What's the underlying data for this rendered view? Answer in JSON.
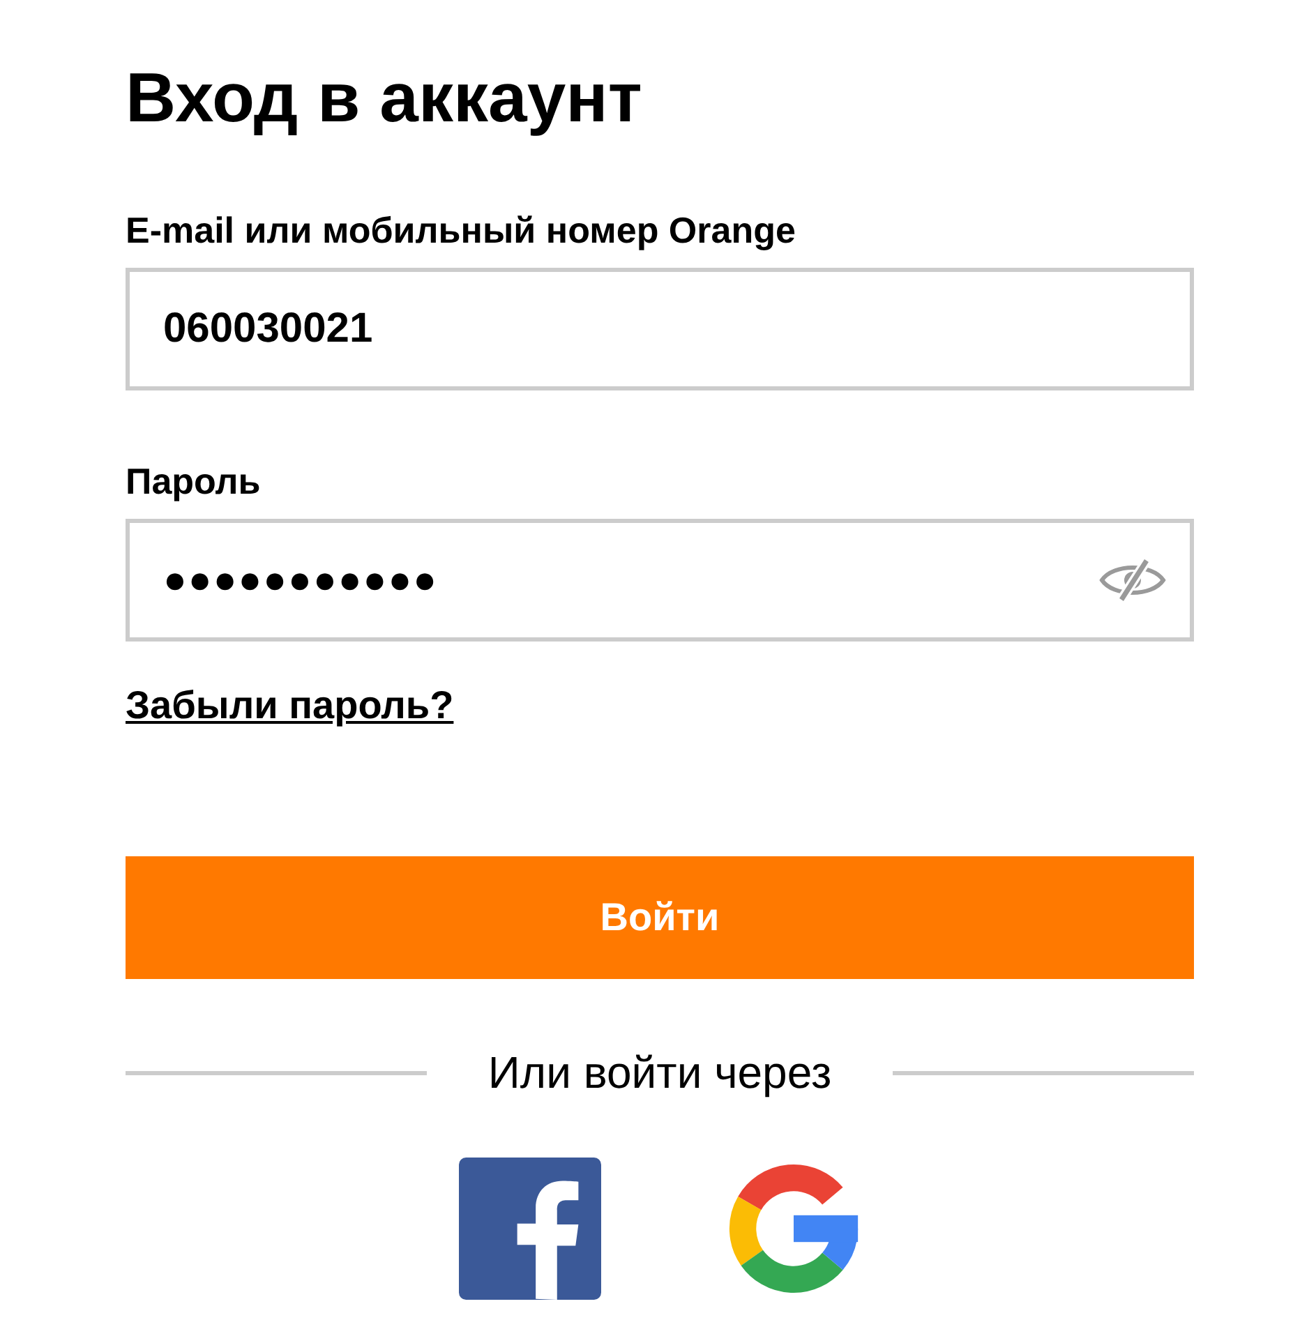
{
  "title": "Вход в аккаунт",
  "login_field": {
    "label": "E-mail или мобильный номер Orange",
    "value": "060030021"
  },
  "password_field": {
    "label": "Пароль",
    "value": "●●●●●●●●●●●",
    "show_password": false
  },
  "forgot_link": "Забыли пароль?",
  "submit_button": "Войти",
  "social": {
    "caption": "Или войти через",
    "providers": [
      {
        "kind": "facebook"
      },
      {
        "kind": "google"
      }
    ]
  }
}
